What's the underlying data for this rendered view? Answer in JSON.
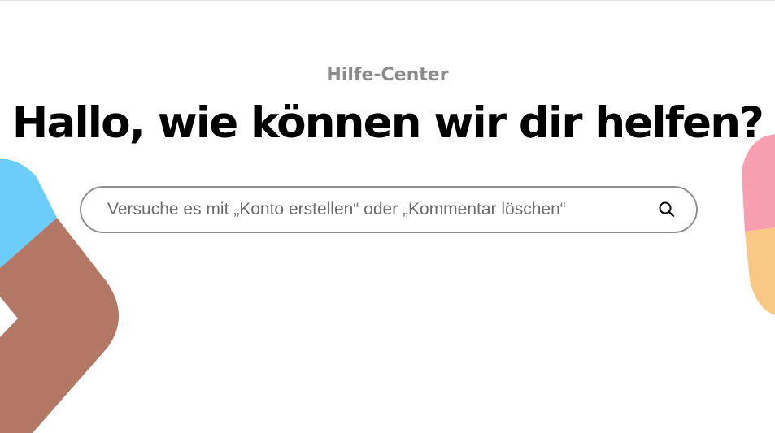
{
  "header": {
    "eyebrow": "Hilfe-Center",
    "title": "Hallo, wie können wir dir helfen?"
  },
  "search": {
    "placeholder": "Versuche es mit „Konto erstellen“ oder „Kommentar löschen“",
    "value": "",
    "icon": "search-icon"
  },
  "colors": {
    "blue_shape": "#6ccdfb",
    "brown_shape": "#b37766",
    "pink_shape": "#f79eb0",
    "orange_shape": "#f8c884",
    "heading": "#000000",
    "eyebrow": "#8a8a8a",
    "search_border": "#8f8f8f"
  }
}
